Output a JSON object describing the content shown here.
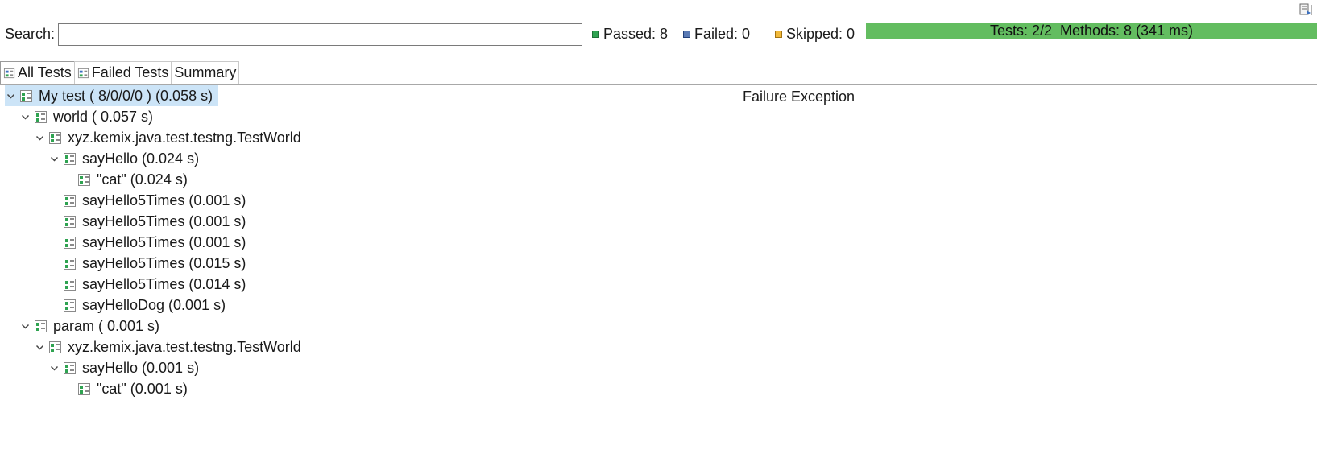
{
  "search": {
    "label": "Search:",
    "value": "",
    "placeholder": ""
  },
  "stats": {
    "passed": "Passed: 8",
    "failed": "Failed: 0",
    "skipped": "Skipped: 0"
  },
  "progress": {
    "text": "Tests: 2/2  Methods: 8 (341 ms)",
    "fraction": 1.0,
    "color": "#63bd60"
  },
  "tabs": [
    {
      "label": "All Tests",
      "icon": "all-tests-icon",
      "active": true
    },
    {
      "label": "Failed Tests",
      "icon": "failed-tests-icon",
      "active": false
    },
    {
      "label": "Summary",
      "icon": "",
      "active": false
    }
  ],
  "tree": [
    {
      "label": "My test ( 8/0/0/0 ) (0.058 s)",
      "depth": 0,
      "expanded": true,
      "selected": true
    },
    {
      "label": "world ( 0.057 s)",
      "depth": 1,
      "expanded": true
    },
    {
      "label": "xyz.kemix.java.test.testng.TestWorld",
      "depth": 2,
      "expanded": true
    },
    {
      "label": "sayHello  (0.024 s)",
      "depth": 3,
      "expanded": true
    },
    {
      "label": "\"cat\"  (0.024 s)",
      "depth": 4,
      "expanded": null
    },
    {
      "label": "sayHello5Times  (0.001 s)",
      "depth": 3,
      "expanded": null
    },
    {
      "label": "sayHello5Times  (0.001 s)",
      "depth": 3,
      "expanded": null
    },
    {
      "label": "sayHello5Times  (0.001 s)",
      "depth": 3,
      "expanded": null
    },
    {
      "label": "sayHello5Times  (0.015 s)",
      "depth": 3,
      "expanded": null
    },
    {
      "label": "sayHello5Times  (0.014 s)",
      "depth": 3,
      "expanded": null
    },
    {
      "label": "sayHelloDog  (0.001 s)",
      "depth": 3,
      "expanded": null
    },
    {
      "label": "param ( 0.001 s)",
      "depth": 1,
      "expanded": true
    },
    {
      "label": "xyz.kemix.java.test.testng.TestWorld",
      "depth": 2,
      "expanded": true
    },
    {
      "label": "sayHello  (0.001 s)",
      "depth": 3,
      "expanded": true
    },
    {
      "label": "\"cat\"  (0.001 s)",
      "depth": 4,
      "expanded": null
    }
  ],
  "exception_panel": {
    "title": "Failure Exception"
  },
  "icons": {
    "corner": "export-report-icon",
    "node": "passed-test-icon"
  }
}
